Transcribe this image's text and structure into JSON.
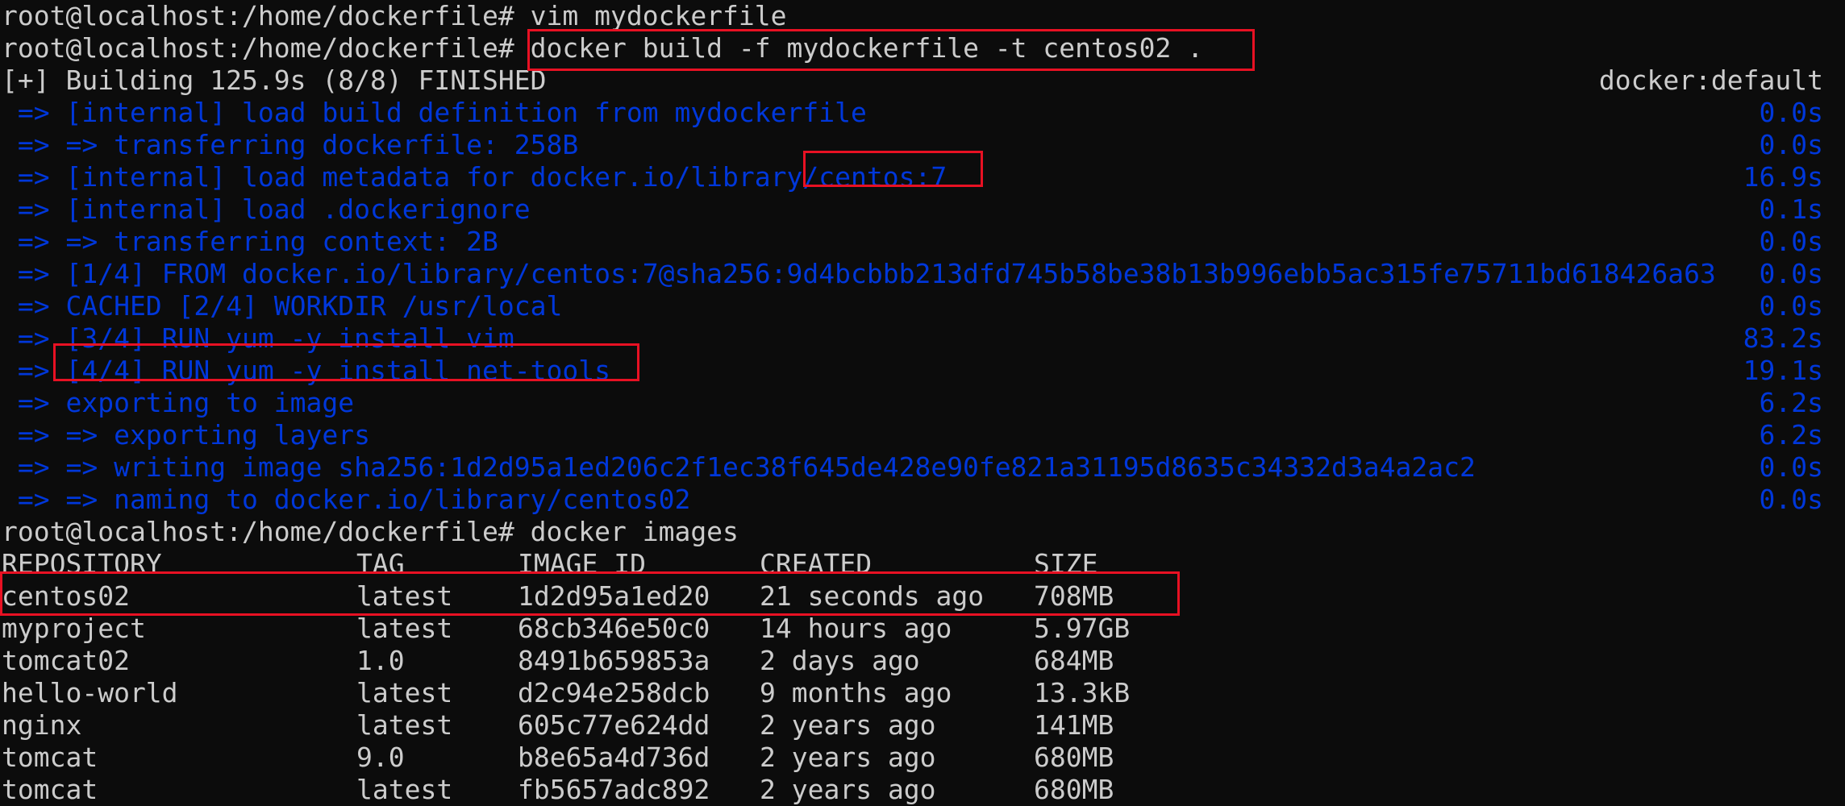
{
  "prompt": "root@localhost:/home/dockerfile#",
  "commands": {
    "vim": "vim mydockerfile",
    "build": "docker build -f mydockerfile -t centos02 .",
    "images": "docker images"
  },
  "build": {
    "status": "[+] Building 125.9s (8/8) FINISHED",
    "context": "docker:default",
    "steps": [
      {
        "text": " => [internal] load build definition from mydockerfile",
        "time": "0.0s"
      },
      {
        "text": " => => transferring dockerfile: 258B",
        "time": "0.0s"
      },
      {
        "text": " => [internal] load metadata for docker.io/library/centos:7",
        "time": "16.9s"
      },
      {
        "text": " => [internal] load .dockerignore",
        "time": "0.1s"
      },
      {
        "text": " => => transferring context: 2B",
        "time": "0.0s"
      },
      {
        "text": " => [1/4] FROM docker.io/library/centos:7@sha256:9d4bcbbb213dfd745b58be38b13b996ebb5ac315fe75711bd618426a63",
        "time": "0.0s"
      },
      {
        "text": " => CACHED [2/4] WORKDIR /usr/local",
        "time": "0.0s"
      },
      {
        "text": " => [3/4] RUN yum -y install vim",
        "time": "83.2s"
      },
      {
        "text": " => [4/4] RUN yum -y install net-tools",
        "time": "19.1s"
      },
      {
        "text": " => exporting to image",
        "time": "6.2s"
      },
      {
        "text": " => => exporting layers",
        "time": "6.2s"
      },
      {
        "text": " => => writing image sha256:1d2d95a1ed206c2f1ec38f645de428e90fe821a31195d8635c34332d3a4a2ac2",
        "time": "0.0s"
      },
      {
        "text": " => => naming to docker.io/library/centos02",
        "time": "0.0s"
      }
    ]
  },
  "images_table": {
    "headers": [
      "REPOSITORY",
      "TAG",
      "IMAGE ID",
      "CREATED",
      "SIZE"
    ],
    "rows": [
      [
        "centos02",
        "latest",
        "1d2d95a1ed20",
        "21 seconds ago",
        "708MB"
      ],
      [
        "myproject",
        "latest",
        "68cb346e50c0",
        "14 hours ago",
        "5.97GB"
      ],
      [
        "tomcat02",
        "1.0",
        "8491b659853a",
        "2 days ago",
        "684MB"
      ],
      [
        "hello-world",
        "latest",
        "d2c94e258dcb",
        "9 months ago",
        "13.3kB"
      ],
      [
        "nginx",
        "latest",
        "605c77e624dd",
        "2 years ago",
        "141MB"
      ],
      [
        "tomcat",
        "9.0",
        "b8e65a4d736d",
        "2 years ago",
        "680MB"
      ],
      [
        "tomcat",
        "latest",
        "fb5657adc892",
        "2 years ago",
        "680MB"
      ]
    ]
  },
  "colors": {
    "background": "#0c0c0c",
    "foreground": "#cccccc",
    "build_step": "#0037da",
    "highlight_box": "#e81123"
  }
}
